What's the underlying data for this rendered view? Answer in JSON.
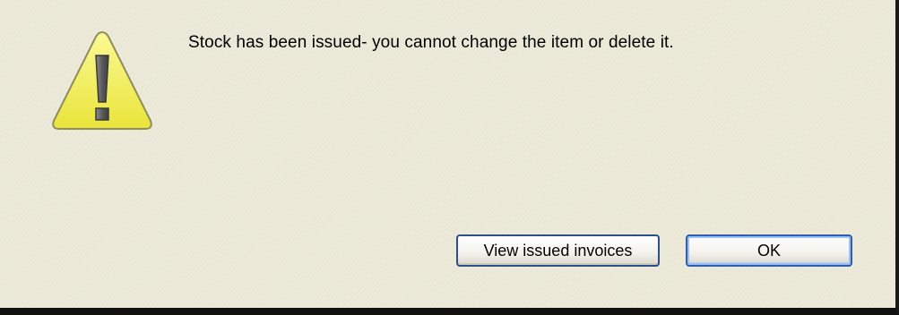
{
  "dialog": {
    "message": "Stock has been issued- you cannot change the item or delete it.",
    "icon": "warning-icon",
    "buttons": {
      "view_issued_invoices": "View issued invoices",
      "ok": "OK"
    }
  },
  "colors": {
    "background": "#ece9d8",
    "icon_fill": "#f7f25a",
    "icon_outline": "#8a8a60",
    "button_border": "#2b4f86",
    "default_button_focus": "#9ec0f5"
  }
}
